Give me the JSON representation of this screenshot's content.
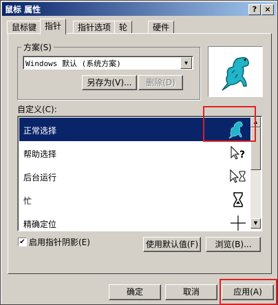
{
  "window": {
    "title": "鼠标 属性",
    "help_btn": "?",
    "close_btn": "×"
  },
  "tabs": [
    "鼠标键",
    "指针",
    "指针选项",
    "轮",
    "硬件"
  ],
  "scheme": {
    "label": "方案(S)",
    "value": "Windows 默认 (系统方案)",
    "save_as": "另存为(V)...",
    "delete": "删除(D)"
  },
  "custom": {
    "label": "自定义(C):",
    "items": [
      {
        "label": "正常选择",
        "icon": "dinosaur-cursor-icon"
      },
      {
        "label": "帮助选择",
        "icon": "help-cursor-icon"
      },
      {
        "label": "后台运行",
        "icon": "working-cursor-icon"
      },
      {
        "label": "忙",
        "icon": "hourglass-icon"
      },
      {
        "label": "精确定位",
        "icon": "crosshair-icon"
      }
    ]
  },
  "shadow_checkbox": {
    "label": "启用指针阴影(E)",
    "checked": true
  },
  "buttons": {
    "use_default": "使用默认值(F)",
    "browse": "浏览(B)...",
    "ok": "确定",
    "cancel": "取消",
    "apply": "应用(A)"
  },
  "colors": {
    "titlebar": "#0a246a",
    "selection": "#0a246a",
    "highlight_box": "#e02020"
  }
}
